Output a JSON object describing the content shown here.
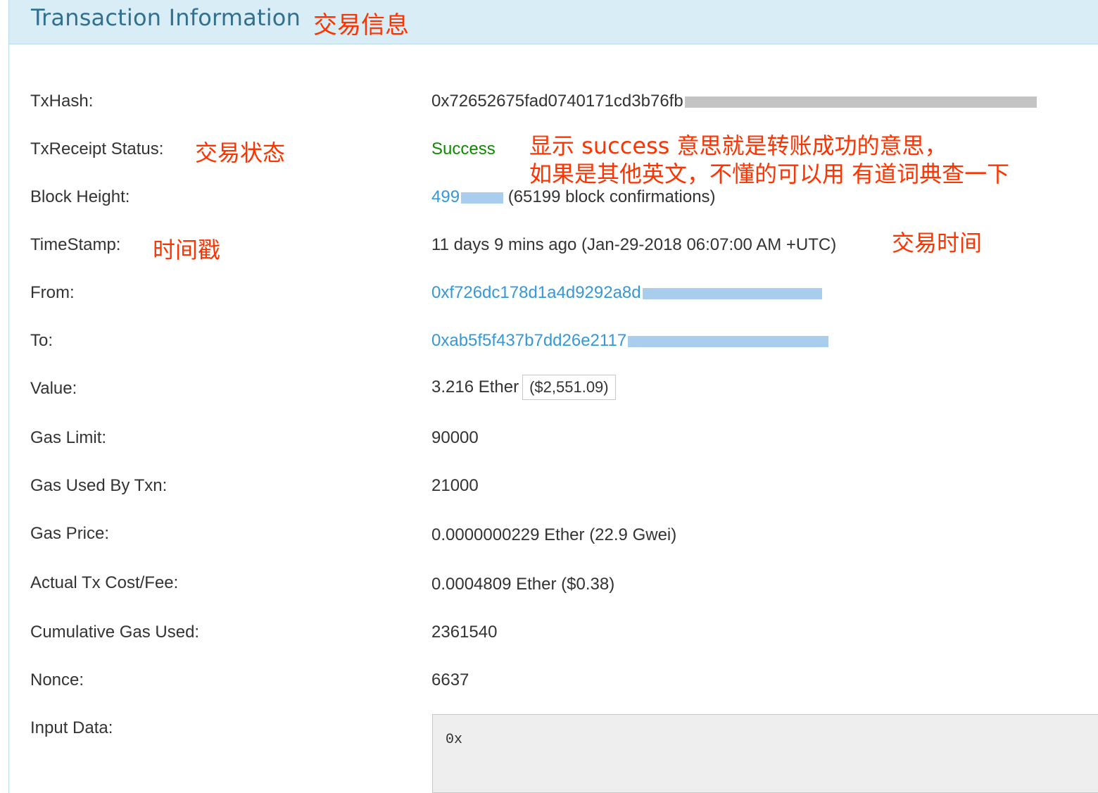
{
  "panel": {
    "title": "Transaction Information",
    "title_annotation": "交易信息"
  },
  "rows": {
    "txhash": {
      "label": "TxHash:",
      "value": "0x72652675fad0740171cd3b76fb"
    },
    "status": {
      "label": "TxReceipt Status:",
      "annotation": "交易状态",
      "value": "Success",
      "note_line1": "显示 success 意思就是转账成功的意思，",
      "note_line2": "如果是其他英文，不懂的可以用 有道词典查一下"
    },
    "block_height": {
      "label": "Block Height:",
      "value": "499",
      "confirmations": "(65199 block confirmations)"
    },
    "timestamp": {
      "label": "TimeStamp:",
      "annotation": "时间戳",
      "value": "11 days 9 mins ago (Jan-29-2018 06:07:00 AM +UTC)",
      "value_annotation": "交易时间"
    },
    "from": {
      "label": "From:",
      "value": "0xf726dc178d1a4d9292a8d"
    },
    "to": {
      "label": "To:",
      "value": "0xab5f5f437b7dd26e2117"
    },
    "value": {
      "label": "Value:",
      "value": "3.216 Ether",
      "usd": "($2,551.09)"
    },
    "gas_limit": {
      "label": "Gas Limit:",
      "value": "90000"
    },
    "gas_used": {
      "label": "Gas Used By Txn:",
      "value": "21000"
    },
    "gas_price": {
      "label": "Gas Price:",
      "value": "0.0000000229 Ether (22.9 Gwei)"
    },
    "tx_fee": {
      "label": "Actual Tx Cost/Fee:",
      "value": "0.0004809 Ether ($0.38)"
    },
    "cumulative_gas": {
      "label": "Cumulative Gas Used:",
      "value": "2361540"
    },
    "nonce": {
      "label": "Nonce:",
      "value": "6637"
    },
    "input_data": {
      "label": "Input Data:",
      "value": "0x"
    }
  },
  "colors": {
    "header_bg": "#d9edf7",
    "title": "#31708f",
    "link": "#3498db",
    "success": "#0d8a00",
    "annotation": "#ff3300"
  }
}
